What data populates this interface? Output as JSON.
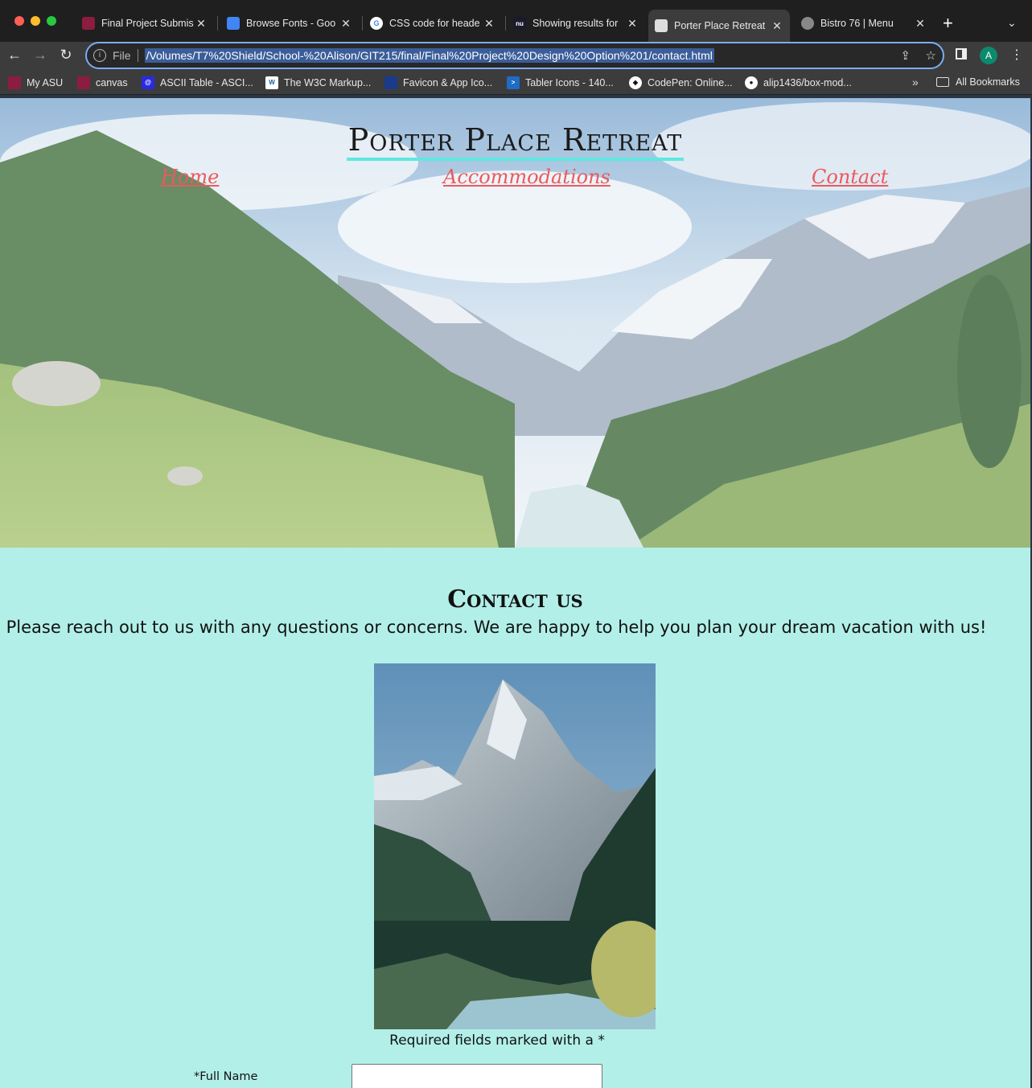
{
  "browser": {
    "tabs": [
      {
        "label": "Final Project Submis",
        "favicon": "asu-icon",
        "color": "#8c1d40",
        "active": false
      },
      {
        "label": "Browse Fonts - Goo",
        "favicon": "google-fonts-icon",
        "color": "#4285f4",
        "active": false
      },
      {
        "label": "CSS code for heade",
        "favicon": "google-icon",
        "color": "#ffffff",
        "active": false
      },
      {
        "label": "Showing results for",
        "favicon": "nu-icon",
        "color": "#1a1a2e",
        "active": false
      },
      {
        "label": "Porter Place Retreat",
        "favicon": "page-icon",
        "color": "#dddddd",
        "active": true
      },
      {
        "label": "Bistro 76 | Menu",
        "favicon": "globe-icon",
        "color": "#888888",
        "active": false
      }
    ],
    "omnibox": {
      "scheme_label": "File",
      "url": "/Volumes/T7%20Shield/School-%20Alison/GIT215/final/Final%20Project%20Design%20Option%201/contact.html"
    },
    "avatar_letter": "A",
    "bookmarks": [
      {
        "label": "My ASU",
        "icon": "asu-icon",
        "color": "#8c1d40"
      },
      {
        "label": "canvas",
        "icon": "asu-icon",
        "color": "#8c1d40"
      },
      {
        "label": "ASCII Table - ASCI...",
        "icon": "at-icon",
        "color": "#2a2ae0"
      },
      {
        "label": "The W3C Markup...",
        "icon": "w3c-icon",
        "color": "#ffffff"
      },
      {
        "label": "Favicon & App Ico...",
        "icon": "favicon-icon",
        "color": "#1a3a8a"
      },
      {
        "label": "Tabler Icons - 140...",
        "icon": "tabler-icon",
        "color": "#206bc4"
      },
      {
        "label": "CodePen: Online...",
        "icon": "codepen-icon",
        "color": "#ffffff"
      },
      {
        "label": "alip1436/box-mod...",
        "icon": "github-icon",
        "color": "#ffffff"
      }
    ],
    "all_bookmarks": "All Bookmarks"
  },
  "site": {
    "title": "Porter Place Retreat",
    "nav": {
      "home": "Home",
      "accommodations": "Accommodations",
      "contact": "Contact"
    },
    "contact_heading": "Contact us",
    "contact_intro": "Please reach out to us with any questions or concerns. We are happy to help you plan your dream vacation with us!",
    "required_note": "Required fields marked with a *",
    "form": {
      "full_name_label": "*Full Name",
      "full_name_value": ""
    }
  },
  "colors": {
    "page_bg": "#b2efe8",
    "nav_link": "#ea5a5e",
    "title_underline": "#5ee8e0"
  }
}
